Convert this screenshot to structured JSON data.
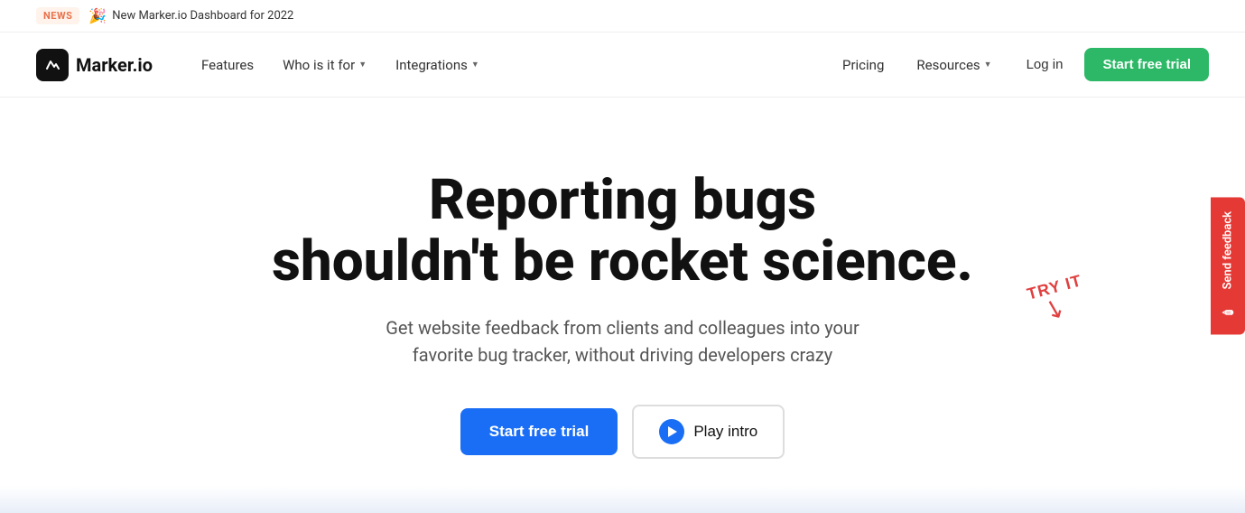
{
  "news_banner": {
    "badge": "NEWS",
    "emoji": "🎉",
    "text": "New Marker.io Dashboard for 2022"
  },
  "header": {
    "logo_text": "Marker.io",
    "nav_left": [
      {
        "label": "Features",
        "has_dropdown": false
      },
      {
        "label": "Who is it for",
        "has_dropdown": true
      },
      {
        "label": "Integrations",
        "has_dropdown": true
      }
    ],
    "nav_right": [
      {
        "label": "Pricing"
      },
      {
        "label": "Resources",
        "has_dropdown": true
      },
      {
        "label": "Log in"
      }
    ],
    "cta_label": "Start free trial"
  },
  "hero": {
    "title_line1": "Reporting bugs",
    "title_line2": "shouldn't be rocket science.",
    "subtitle": "Get website feedback from clients and colleagues into your favorite bug tracker, without driving developers crazy",
    "btn_trial": "Start free trial",
    "btn_play": "Play intro",
    "try_it_label": "TRY IT",
    "feedback_label": "Send feedback"
  }
}
